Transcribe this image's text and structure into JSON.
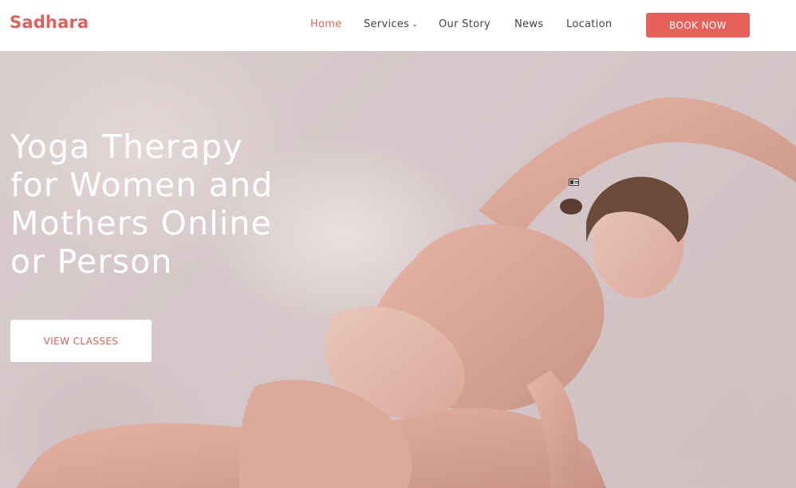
{
  "brand": {
    "logo_text": "Sadhara",
    "accent_color": "#e0615c"
  },
  "nav": {
    "items": [
      {
        "label": "Home",
        "active": true
      },
      {
        "label": "Services",
        "has_dropdown": true
      },
      {
        "label": "Our Story"
      },
      {
        "label": "News"
      },
      {
        "label": "Location"
      }
    ],
    "dropdown_icon": "chevron-down-icon",
    "book_button": "BOOK NOW"
  },
  "hero": {
    "title_lines": [
      "Yoga Therapy",
      "for Women and",
      "Mothers Online",
      "or Person"
    ],
    "cta_label": "VIEW CLASSES",
    "image_subject": "woman-yoga-side-stretch",
    "overlay_icon": "id-card-icon"
  }
}
